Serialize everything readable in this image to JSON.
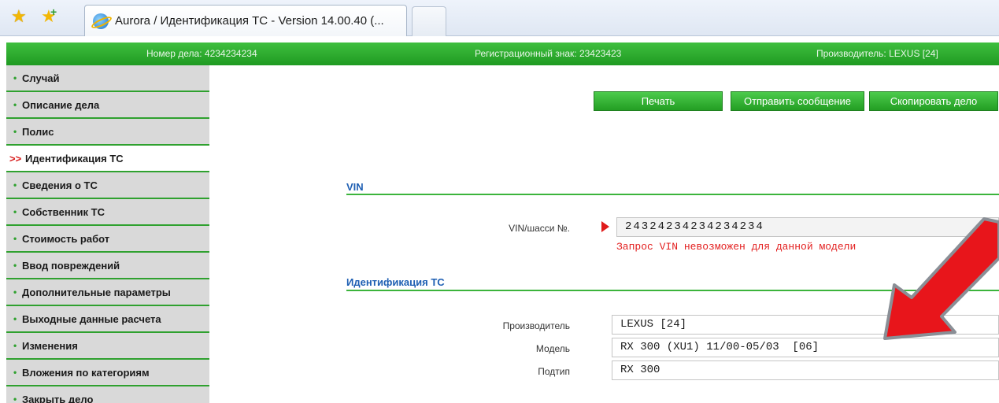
{
  "browser": {
    "favorites_icon": "star-icon",
    "add_favorites_icon": "add-favorite-icon",
    "tab_title": "Aurora / Идентификация ТС - Version 14.00.40 (...",
    "tab_icon": "ie-icon"
  },
  "header": {
    "case_number": "Номер дела: 4234234234",
    "registration": "Регистрационный знак: 23423423",
    "manufacturer": "Производитель: LEXUS [24]"
  },
  "sidebar": {
    "items": [
      {
        "bullet": "•",
        "label": "Случай"
      },
      {
        "bullet": "•",
        "label": "Описание дела"
      },
      {
        "bullet": "•",
        "label": "Полис"
      },
      {
        "bullet": ">>",
        "label": "Идентификация ТС",
        "active": true
      },
      {
        "bullet": "•",
        "label": "Сведения о ТС"
      },
      {
        "bullet": "•",
        "label": "Собственник ТС"
      },
      {
        "bullet": "•",
        "label": "Стоимость работ"
      },
      {
        "bullet": "•",
        "label": "Ввод повреждений"
      },
      {
        "bullet": "•",
        "label": "Дополнительные параметры"
      },
      {
        "bullet": "•",
        "label": "Выходные данные расчета"
      },
      {
        "bullet": "•",
        "label": "Изменения"
      },
      {
        "bullet": "•",
        "label": "Вложения по категориям"
      },
      {
        "bullet": "•",
        "label": "Закрыть дело"
      }
    ]
  },
  "toolbar": {
    "print_label": "Печать",
    "send_label": "Отправить сообщение",
    "copy_label": "Скопировать дело"
  },
  "vin_section": {
    "title": "VIN",
    "vin_label": "VIN/шасси №.",
    "vin_value": "24324234234234234",
    "vin_error": "Запрос VIN невозможен для данной модели"
  },
  "ident_section": {
    "title": "Идентификация ТС",
    "fields": [
      {
        "label": "Производитель",
        "value": "LEXUS [24]"
      },
      {
        "label": "Модель",
        "value": "RX 300 (XU1) 11/00-05/03  [06]"
      },
      {
        "label": "Подтип",
        "value": "RX 300"
      }
    ]
  },
  "colors": {
    "accent_green": "#2fa12f",
    "section_blue": "#1e5fb3",
    "error_red": "#e32020",
    "annotation_red": "#e8151b"
  }
}
